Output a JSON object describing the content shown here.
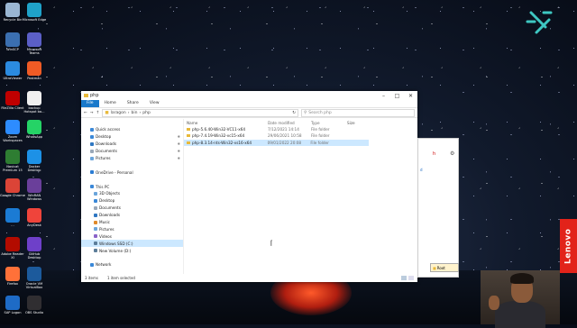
{
  "desktop_icons": [
    {
      "id": "recycle-bin",
      "label": "Recycle Bin",
      "color": "#9ab6d3"
    },
    {
      "id": "edge",
      "label": "Microsoft Edge",
      "color": "#1fa2c9"
    },
    {
      "id": "winscp",
      "label": "WinSCP",
      "color": "#3b6fb0"
    },
    {
      "id": "teams",
      "label": "Microsoft Teams",
      "color": "#5b5fc7"
    },
    {
      "id": "ultraviewer",
      "label": "UltraViewer",
      "color": "#2b8be0"
    },
    {
      "id": "postman",
      "label": "Postman",
      "color": "#ef5b25"
    },
    {
      "id": "filezilla",
      "label": "FileZilla Client",
      "color": "#bf0000"
    },
    {
      "id": "backup-hotspot",
      "label": "backup Hotspot ba...",
      "color": "#f0f0f0"
    },
    {
      "id": "zoom",
      "label": "Zoom Workspaces",
      "color": "#2d8cff"
    },
    {
      "id": "whatsapp",
      "label": "WhatsApp",
      "color": "#25d366"
    },
    {
      "id": "navicat",
      "label": "Navicat Premium 15",
      "color": "#2e7d32"
    },
    {
      "id": "docker",
      "label": "Docker Desktop",
      "color": "#1d91e6"
    },
    {
      "id": "chrome",
      "label": "Google Chrome",
      "color": "#db4437"
    },
    {
      "id": "winrar",
      "label": "WinRAR Windows",
      "color": "#6a3f9a"
    },
    {
      "id": "vpn",
      "label": "...",
      "color": "#1b7bd4"
    },
    {
      "id": "anydesk",
      "label": "AnyDesk",
      "color": "#ef443b"
    },
    {
      "id": "adobe",
      "label": "Adobe Reader XI",
      "color": "#b30b00"
    },
    {
      "id": "github",
      "label": "GitHub Desktop",
      "color": "#6e40c9"
    },
    {
      "id": "firefox",
      "label": "Firefox",
      "color": "#ff7139"
    },
    {
      "id": "virtualbox",
      "label": "Oracle VM VirtualBox",
      "color": "#1c5a9c"
    },
    {
      "id": "sap",
      "label": "SAP Logon",
      "color": "#1e6bc6"
    },
    {
      "id": "obs",
      "label": "OBS Studio",
      "color": "#302e31"
    }
  ],
  "explorer": {
    "title": "php",
    "ribbon_tabs": [
      "File",
      "Home",
      "Share",
      "View"
    ],
    "breadcrumb": [
      "laragon",
      "bin",
      "php"
    ],
    "search_placeholder": "Search php",
    "nav_items": [
      {
        "label": "Quick access",
        "pin": false,
        "color": "#3a88d8",
        "selected": false
      },
      {
        "label": "Desktop",
        "pin": true,
        "color": "#3a88d8",
        "selected": false
      },
      {
        "label": "Downloads",
        "pin": true,
        "color": "#2f77c2",
        "selected": false
      },
      {
        "label": "Documents",
        "pin": true,
        "color": "#9aa8b8",
        "selected": false
      },
      {
        "label": "Pictures",
        "pin": true,
        "color": "#6aa5db",
        "selected": false
      },
      {
        "label": "",
        "pin": false,
        "color": "transparent",
        "selected": false
      },
      {
        "label": "OneDrive - Personal",
        "pin": false,
        "color": "#2b7cd3",
        "selected": false
      },
      {
        "label": "",
        "pin": false,
        "color": "transparent",
        "selected": false
      },
      {
        "label": "This PC",
        "pin": false,
        "color": "#3a88d8",
        "selected": false
      },
      {
        "label": "3D Objects",
        "pin": false,
        "color": "#6aa5db",
        "selected": false
      },
      {
        "label": "Desktop",
        "pin": false,
        "color": "#3a88d8",
        "selected": false
      },
      {
        "label": "Documents",
        "pin": false,
        "color": "#9aa8b8",
        "selected": false
      },
      {
        "label": "Downloads",
        "pin": false,
        "color": "#2f77c2",
        "selected": false
      },
      {
        "label": "Music",
        "pin": false,
        "color": "#e08a2b",
        "selected": false
      },
      {
        "label": "Pictures",
        "pin": false,
        "color": "#6aa5db",
        "selected": false
      },
      {
        "label": "Videos",
        "pin": false,
        "color": "#8a63c9",
        "selected": false
      },
      {
        "label": "Windows SSD (C:)",
        "pin": false,
        "color": "#5c7d99",
        "selected": true
      },
      {
        "label": "New Volume (D:)",
        "pin": false,
        "color": "#5c7d99",
        "selected": false
      },
      {
        "label": "",
        "pin": false,
        "color": "transparent",
        "selected": false
      },
      {
        "label": "Network",
        "pin": false,
        "color": "#3a88d8",
        "selected": false
      }
    ],
    "columns": [
      "Name",
      "Date modified",
      "Type",
      "Size"
    ],
    "files": [
      {
        "name": "php-5.6.40-Win32-VC11-x64",
        "date": "7/12/2021 14:14",
        "type": "File folder",
        "size": "",
        "selected": false
      },
      {
        "name": "php-7.4.19-Win32-vc15-x64",
        "date": "29/06/2021 10:58",
        "type": "File folder",
        "size": "",
        "selected": false
      },
      {
        "name": "php-8.3.14-nts-Win32-vs16-x64",
        "date": "09/01/2022 20:08",
        "type": "File folder",
        "size": "",
        "selected": true
      }
    ],
    "status_items": "3 items",
    "status_selected": "1 item selected"
  },
  "background_window": {
    "root_label": "Root"
  },
  "brand": {
    "lenovo": "Lenovo"
  }
}
